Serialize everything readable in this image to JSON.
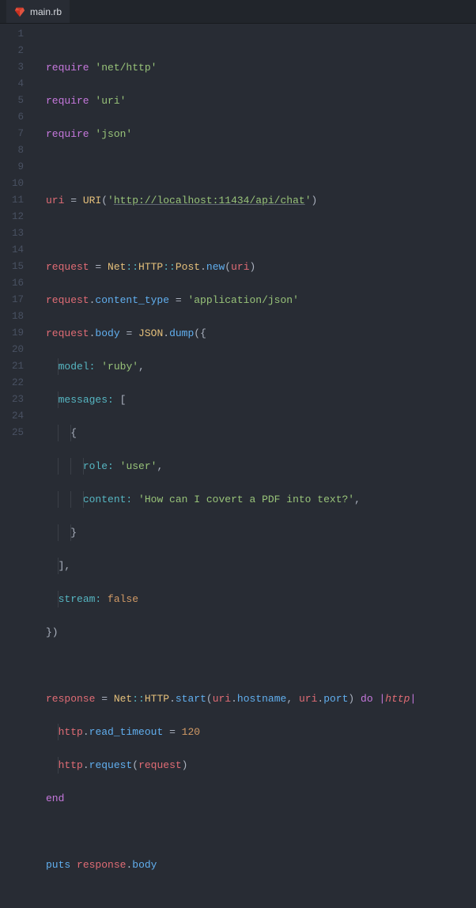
{
  "tab": {
    "filename": "main.rb"
  },
  "gutter": {
    "lines": 25
  },
  "tokens": {
    "kw_require": "require",
    "str_nethttp": "'net/http'",
    "str_uri": "'uri'",
    "str_json": "'json'",
    "var_uri": "uri",
    "eq": " = ",
    "cls_URI": "URI",
    "lparen": "(",
    "rparen": ")",
    "url_quote": "'",
    "url_text": "http://localhost:11434/api/chat",
    "var_request": "request",
    "cls_Net": "Net",
    "dbl": "::",
    "cls_HTTP": "HTTP",
    "cls_Post": "Post",
    "dot": ".",
    "fn_new": "new",
    "attr_content_type": "content_type",
    "str_appjson": "'application/json'",
    "attr_body": "body",
    "cls_JSON": "JSON",
    "fn_dump": "dump",
    "lbrace": "{",
    "rbrace": "}",
    "sym_model": "model:",
    "str_ruby": "'ruby'",
    "comma": ",",
    "sym_messages": "messages:",
    "lbracket": "[",
    "rbracket": "]",
    "sym_role": "role:",
    "str_user": "'user'",
    "sym_content": "content:",
    "str_question": "'How can I covert a PDF into text?'",
    "sym_stream": "stream:",
    "bool_false": "false",
    "rbrace_paren": "})",
    "var_response": "response",
    "fn_start": "start",
    "fn_hostname": "hostname",
    "fn_port": "port",
    "kw_do": "do",
    "pipe": "|",
    "param_http": "http",
    "attr_read_timeout": "read_timeout",
    "num_120": "120",
    "fn_request": "request",
    "kw_end": "end",
    "fn_puts": "puts"
  }
}
